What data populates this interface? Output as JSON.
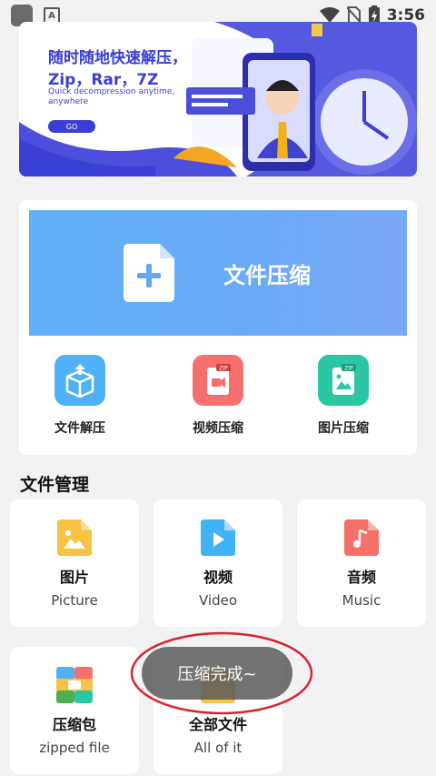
{
  "status_bar": {
    "time": "3:56",
    "icons": [
      "app-square-icon",
      "a-notification-icon",
      "wifi-icon",
      "no-sim-icon",
      "battery-charging-icon"
    ]
  },
  "banner": {
    "title": "随时随地快速解压，Zip，Rar，7Z",
    "subtitle": "Quick decompression anytime, anywhere",
    "go_label": "GO"
  },
  "compress": {
    "label": "文件压缩"
  },
  "tools": [
    {
      "label": "文件解压",
      "icon": "box-unzip-icon",
      "color": "#4fb1f7"
    },
    {
      "label": "视频压缩",
      "icon": "video-zip-icon",
      "color": "#f66f6f"
    },
    {
      "label": "图片压缩",
      "icon": "image-zip-icon",
      "color": "#2bc7a4"
    }
  ],
  "file_management": {
    "title": "文件管理",
    "tiles": [
      {
        "cn": "图片",
        "en": "Picture",
        "icon": "picture-file-icon",
        "color": "#f8c244"
      },
      {
        "cn": "视频",
        "en": "Video",
        "icon": "video-file-icon",
        "color": "#3fb3f3"
      },
      {
        "cn": "音频",
        "en": "Music",
        "icon": "music-file-icon",
        "color": "#f47068"
      },
      {
        "cn": "压缩包",
        "en": "zipped file",
        "icon": "zip-package-icon",
        "color": "#4caf50"
      },
      {
        "cn": "全部文件",
        "en": "All of it",
        "icon": "all-files-icon",
        "color": "#f8c244"
      }
    ]
  },
  "toast": {
    "text": "压缩完成~"
  },
  "colors": {
    "accent_blue": "#3a3fd6",
    "page_bg": "#f2f2f4",
    "highlight_red": "#d9232a"
  }
}
